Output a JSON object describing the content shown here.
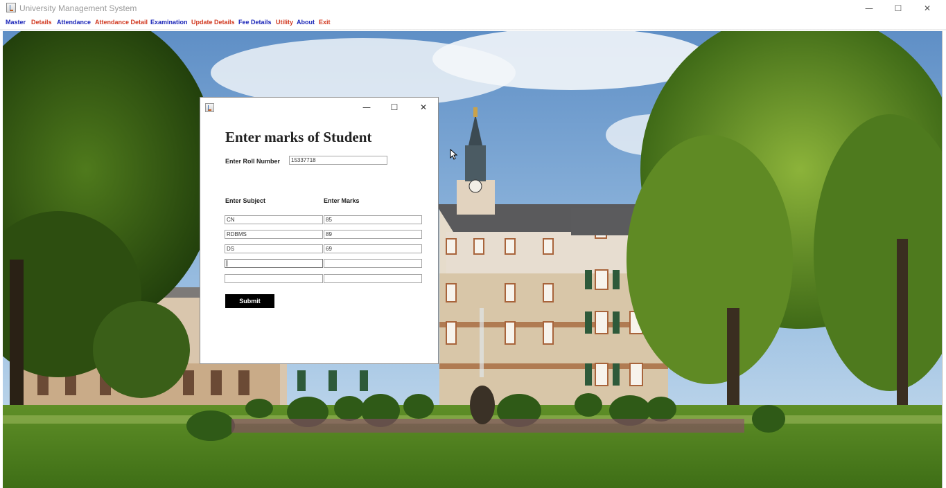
{
  "window": {
    "title": "University Management System",
    "controls": {
      "minimize": "—",
      "maximize": "☐",
      "close": "✕"
    }
  },
  "menu": [
    {
      "label": "Master",
      "color": "#1a25b8"
    },
    {
      "label": "Details",
      "color": "#d0371e"
    },
    {
      "label": "Attendance",
      "color": "#1a25b8"
    },
    {
      "label": "Attendance Detail",
      "color": "#d0371e"
    },
    {
      "label": "Examination",
      "color": "#1a25b8"
    },
    {
      "label": "Update Details",
      "color": "#d0371e"
    },
    {
      "label": "Fee Details",
      "color": "#1a25b8"
    },
    {
      "label": "Utility",
      "color": "#d0371e"
    },
    {
      "label": "About",
      "color": "#1a25b8"
    },
    {
      "label": "Exit",
      "color": "#d0371e"
    }
  ],
  "dialog": {
    "controls": {
      "minimize": "—",
      "maximize": "☐",
      "close": "✕"
    },
    "heading": "Enter marks of Student",
    "roll_label": "Enter Roll Number",
    "roll_value": "15337718",
    "subject_label": "Enter Subject",
    "marks_label": "Enter Marks",
    "rows": [
      {
        "subject": "CN",
        "marks": "85"
      },
      {
        "subject": "RDBMS",
        "marks": "89"
      },
      {
        "subject": "DS",
        "marks": "69"
      },
      {
        "subject": "",
        "marks": ""
      },
      {
        "subject": "",
        "marks": ""
      }
    ],
    "submit_label": "Submit"
  },
  "icons": [
    "java-app-icon",
    "minimize-icon",
    "maximize-icon",
    "close-icon",
    "mouse-cursor-icon"
  ],
  "background": "university campus building with trees and lawn"
}
